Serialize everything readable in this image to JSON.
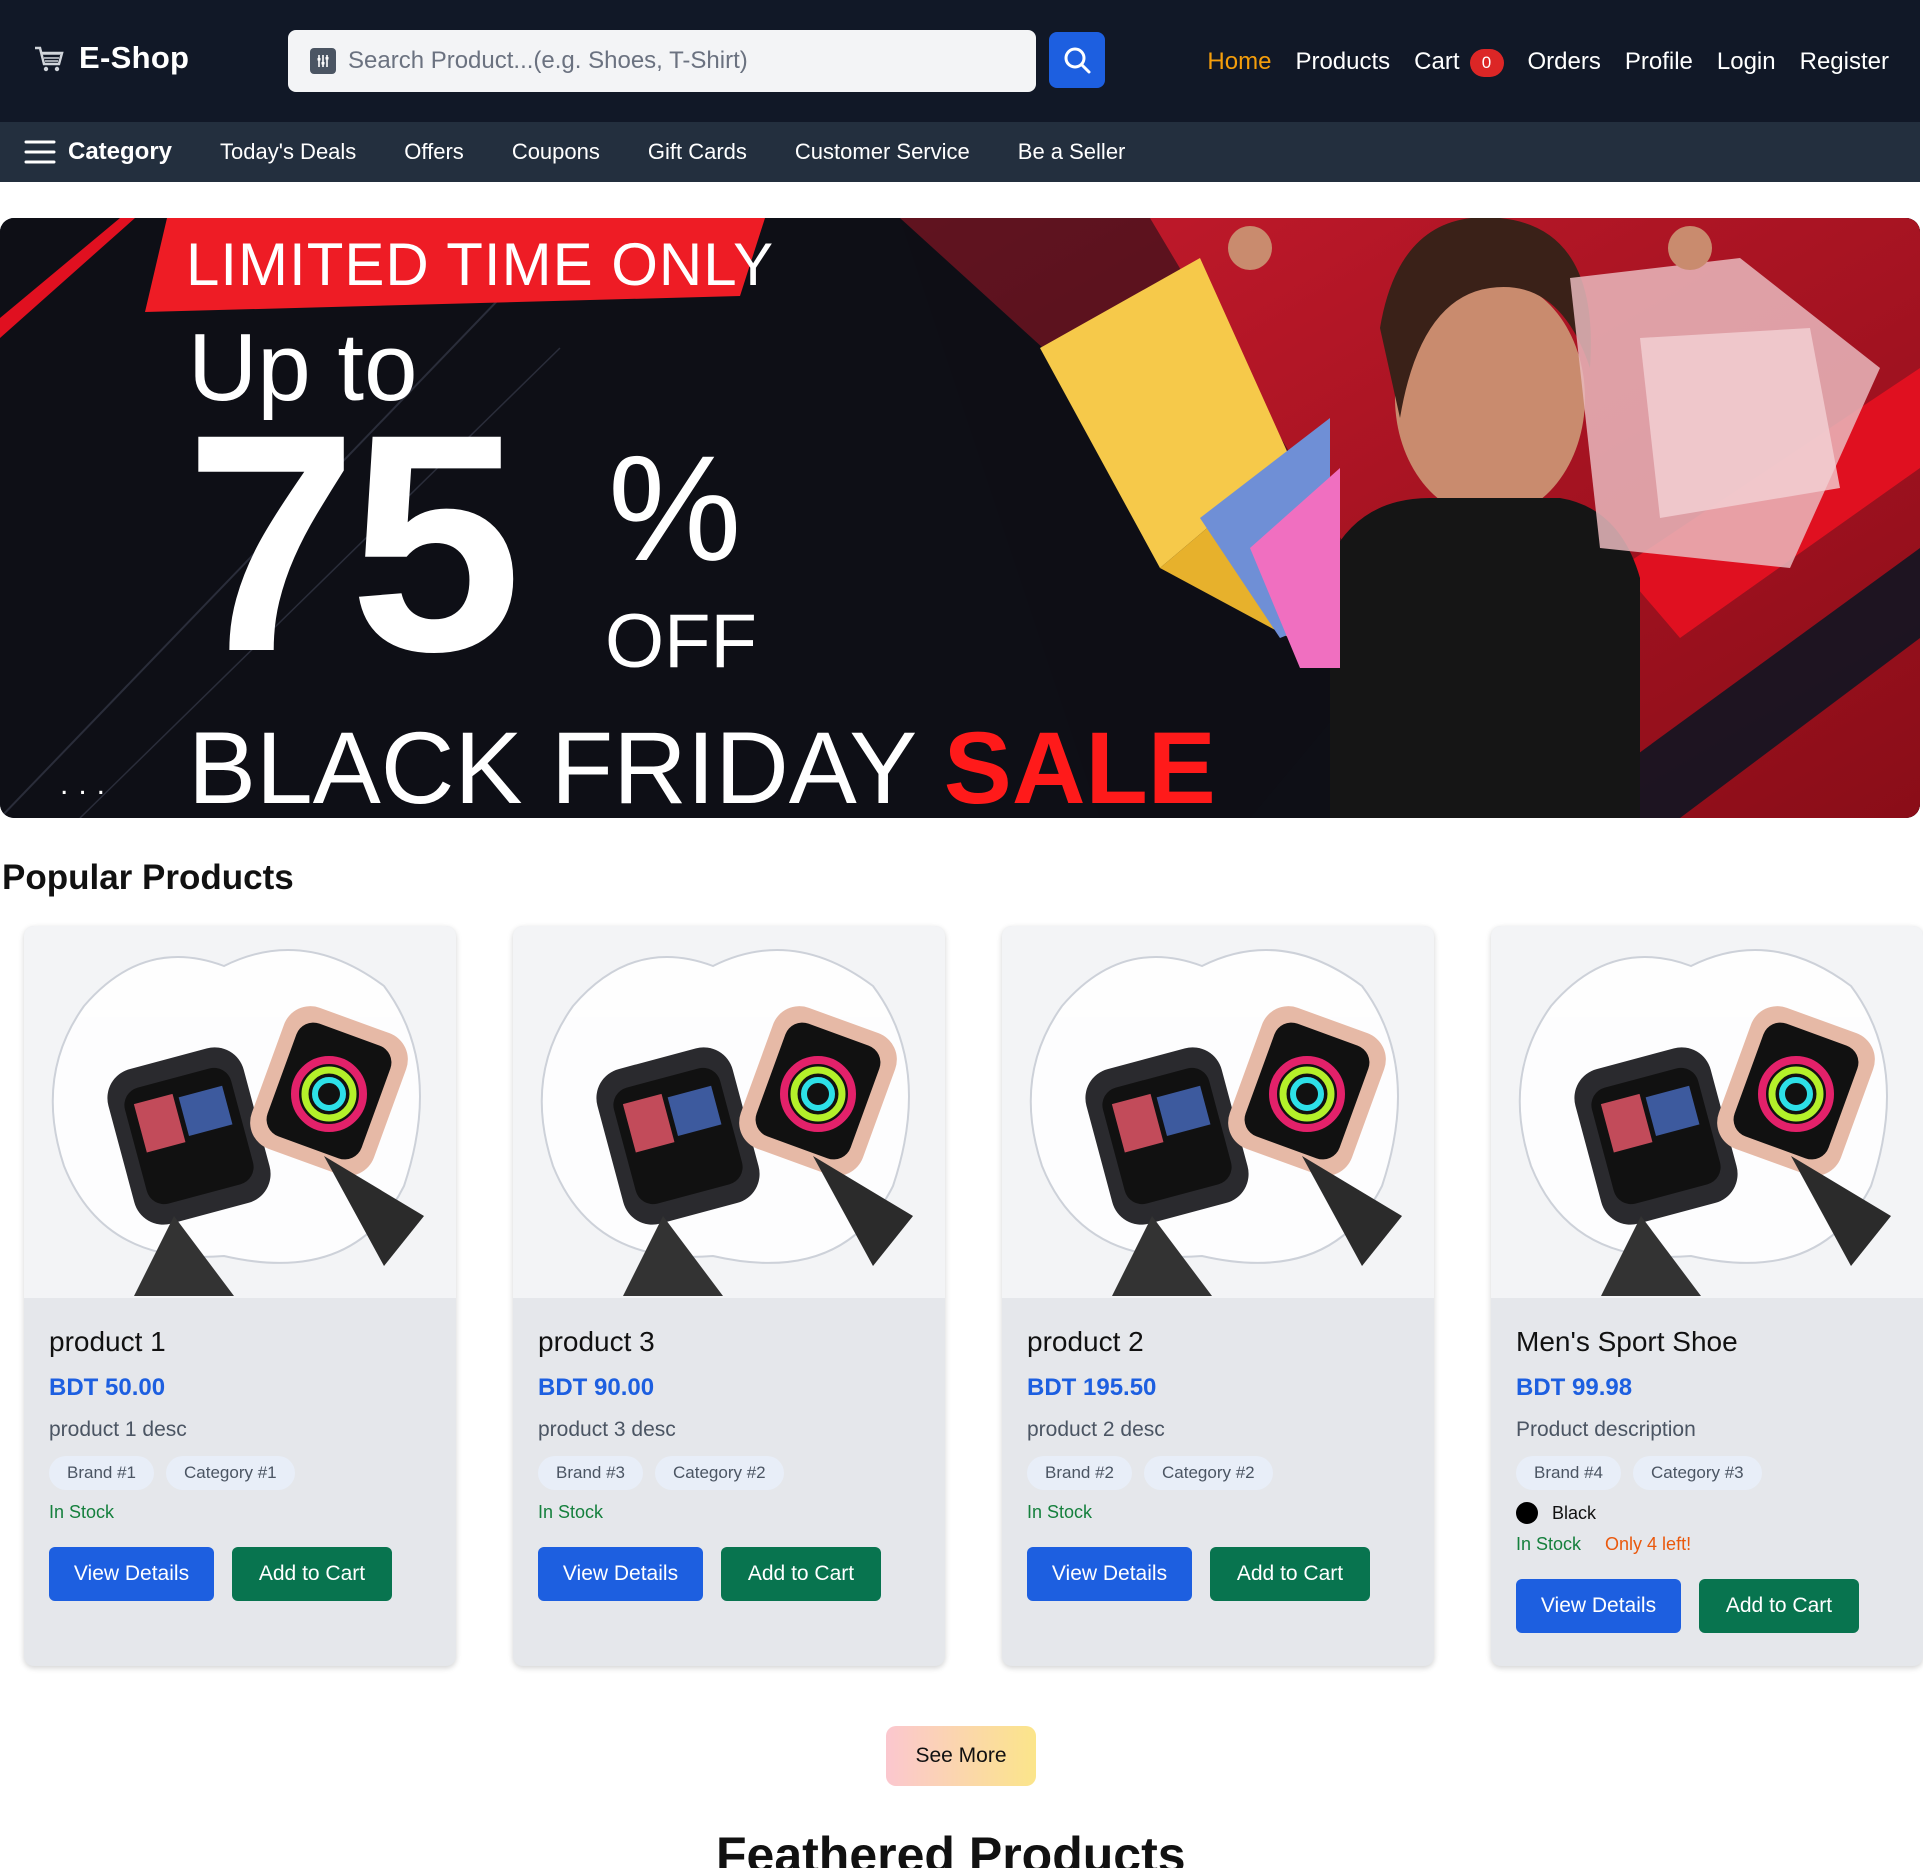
{
  "header": {
    "brand": "E-Shop",
    "search_placeholder": "Search Product...(e.g. Shoes, T-Shirt)",
    "nav": [
      "Home",
      "Products",
      "Cart",
      "Orders",
      "Profile",
      "Login",
      "Register"
    ],
    "active_nav": "Home",
    "cart_count": "0",
    "colors": {
      "bg": "#111827",
      "active": "#f59e0b",
      "badge": "#dc2626",
      "search_btn": "#1d5fe0"
    }
  },
  "subnav": {
    "category_label": "Category",
    "items": [
      "Today's Deals",
      "Offers",
      "Coupons",
      "Gift Cards",
      "Customer Service",
      "Be a Seller"
    ]
  },
  "banner": {
    "tagline": "LIMITED TIME ONLY",
    "up_to": "Up to",
    "percent": "75",
    "percent_sign": "%",
    "off": "OFF",
    "headline": "BLACK FRIDAY",
    "headline_accent": "SALE",
    "dots": "..."
  },
  "popular": {
    "title": "Popular Products",
    "products": [
      {
        "name": "product 1",
        "price": "BDT 50.00",
        "desc": "product 1 desc",
        "brand": "Brand #1",
        "category": "Category #1",
        "stock": "In Stock",
        "view": "View Details",
        "add": "Add to Cart"
      },
      {
        "name": "product 3",
        "price": "BDT 90.00",
        "desc": "product 3 desc",
        "brand": "Brand #3",
        "category": "Category #2",
        "stock": "In Stock",
        "view": "View Details",
        "add": "Add to Cart"
      },
      {
        "name": "product 2",
        "price": "BDT 195.50",
        "desc": "product 2 desc",
        "brand": "Brand #2",
        "category": "Category #2",
        "stock": "In Stock",
        "view": "View Details",
        "add": "Add to Cart"
      },
      {
        "name": "Men's Sport Shoe",
        "price": "BDT 99.98",
        "desc": "Product description",
        "brand": "Brand #4",
        "category": "Category #3",
        "color": "Black",
        "stock": "In Stock",
        "low_stock": "Only 4 left!",
        "view": "View Details",
        "add": "Add to Cart"
      }
    ],
    "see_more": "See More"
  },
  "featured": {
    "title": "Feathered Products"
  }
}
